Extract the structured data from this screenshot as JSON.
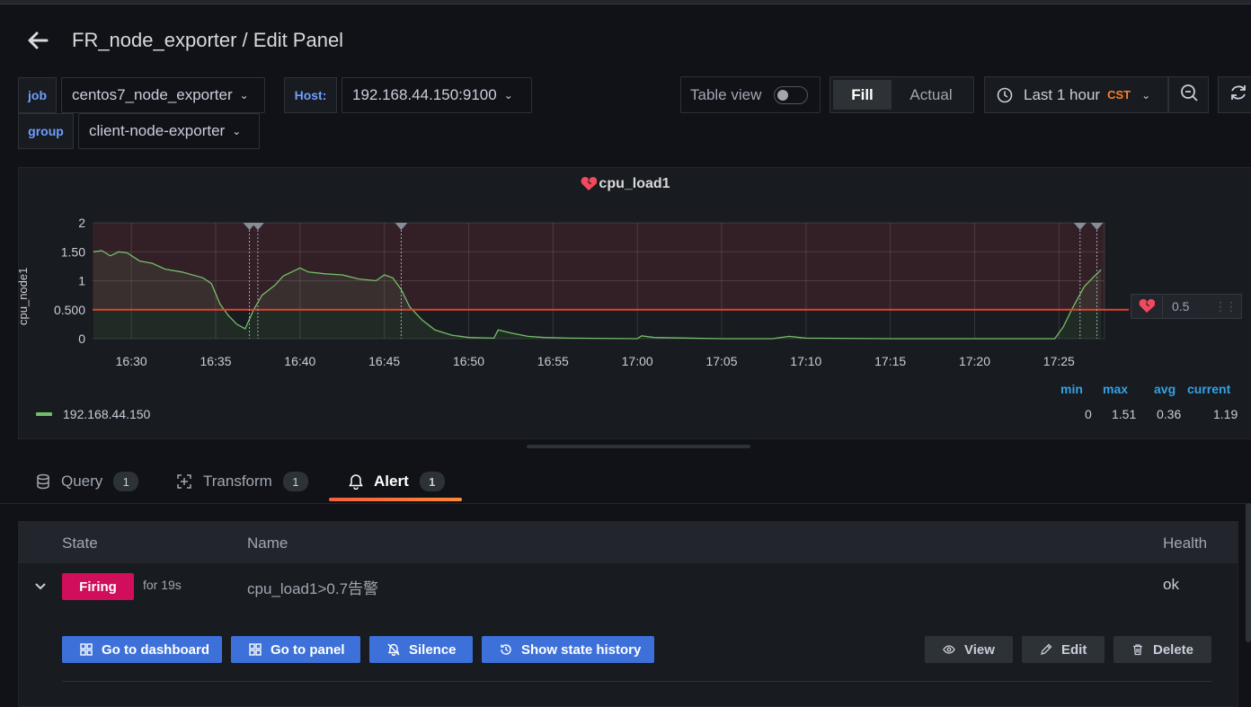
{
  "header": {
    "title": "FR_node_exporter / Edit Panel"
  },
  "variables": [
    {
      "label": "job",
      "value": "centos7_node_exporter"
    },
    {
      "label": "Host:",
      "value": "192.168.44.150:9100"
    },
    {
      "label": "group",
      "value": "client-node-exporter"
    }
  ],
  "toolbar": {
    "table_view_label": "Table view",
    "fill_label": "Fill",
    "actual_label": "Actual",
    "time_range": "Last 1 hour",
    "timezone": "CST"
  },
  "panel": {
    "title": "cpu_load1",
    "threshold_value": "0.5",
    "legend": {
      "headers": [
        "min",
        "max",
        "avg",
        "current"
      ],
      "series_name": "192.168.44.150",
      "series_color": "#73bf69",
      "values": [
        "0",
        "1.51",
        "0.36",
        "1.19"
      ]
    }
  },
  "chart_data": {
    "type": "line",
    "title": "cpu_load1",
    "ylabel": "cpu_node1",
    "ylim": [
      0,
      2
    ],
    "y_ticks": [
      "0",
      "0.500",
      "1",
      "1.50",
      "2"
    ],
    "x_ticks": [
      "16:30",
      "16:35",
      "16:40",
      "16:45",
      "16:50",
      "16:55",
      "17:00",
      "17:05",
      "17:10",
      "17:15",
      "17:20",
      "17:25"
    ],
    "threshold": 0.5,
    "annotations": [
      "16:37:30",
      "16:46:00",
      "17:26:15",
      "17:27:15"
    ],
    "series": [
      {
        "name": "192.168.44.150",
        "color": "#73bf69",
        "points": [
          [
            "16:27:45",
            1.5
          ],
          [
            "16:28:15",
            1.52
          ],
          [
            "16:28:45",
            1.43
          ],
          [
            "16:29:15",
            1.5
          ],
          [
            "16:29:45",
            1.48
          ],
          [
            "16:30:30",
            1.34
          ],
          [
            "16:31:15",
            1.3
          ],
          [
            "16:32:00",
            1.2
          ],
          [
            "16:33:00",
            1.15
          ],
          [
            "16:34:15",
            1.05
          ],
          [
            "16:34:45",
            0.95
          ],
          [
            "16:35:15",
            0.6
          ],
          [
            "16:35:45",
            0.4
          ],
          [
            "16:36:15",
            0.25
          ],
          [
            "16:36:45",
            0.17
          ],
          [
            "16:37:15",
            0.5
          ],
          [
            "16:37:45",
            0.75
          ],
          [
            "16:38:30",
            0.92
          ],
          [
            "16:39:00",
            1.08
          ],
          [
            "16:39:30",
            1.15
          ],
          [
            "16:40:00",
            1.22
          ],
          [
            "16:40:30",
            1.15
          ],
          [
            "16:41:30",
            1.12
          ],
          [
            "16:42:30",
            1.1
          ],
          [
            "16:43:30",
            1.03
          ],
          [
            "16:44:30",
            1.0
          ],
          [
            "16:45:00",
            1.1
          ],
          [
            "16:45:30",
            1.05
          ],
          [
            "16:46:00",
            0.85
          ],
          [
            "16:46:30",
            0.55
          ],
          [
            "16:47:15",
            0.32
          ],
          [
            "16:48:00",
            0.15
          ],
          [
            "16:49:00",
            0.06
          ],
          [
            "16:50:00",
            0.02
          ],
          [
            "16:51:30",
            0.01
          ],
          [
            "16:51:45",
            0.15
          ],
          [
            "16:52:30",
            0.1
          ],
          [
            "16:53:30",
            0.04
          ],
          [
            "16:54:30",
            0.02
          ],
          [
            "16:56:00",
            0.01
          ],
          [
            "17:00:00",
            0.0
          ],
          [
            "17:00:15",
            0.05
          ],
          [
            "17:01:00",
            0.02
          ],
          [
            "17:05:00",
            0.0
          ],
          [
            "17:08:00",
            0.0
          ],
          [
            "17:09:00",
            0.04
          ],
          [
            "17:10:00",
            0.01
          ],
          [
            "17:15:00",
            0.0
          ],
          [
            "17:20:00",
            0.0
          ],
          [
            "17:24:45",
            0.0
          ],
          [
            "17:25:15",
            0.2
          ],
          [
            "17:25:45",
            0.5
          ],
          [
            "17:26:30",
            0.9
          ],
          [
            "17:27:00",
            1.05
          ],
          [
            "17:27:30",
            1.19
          ]
        ]
      }
    ]
  },
  "tabs": [
    {
      "label": "Query",
      "count": "1"
    },
    {
      "label": "Transform",
      "count": "1"
    },
    {
      "label": "Alert",
      "count": "1"
    }
  ],
  "alert_table": {
    "headers": {
      "state": "State",
      "name": "Name",
      "health": "Health"
    },
    "row": {
      "state": "Firing",
      "duration": "for 19s",
      "name": "cpu_load1>0.7告警",
      "health": "ok"
    },
    "actions": {
      "go_to_dashboard": "Go to dashboard",
      "go_to_panel": "Go to panel",
      "silence": "Silence",
      "show_state_history": "Show state history",
      "view": "View",
      "edit": "Edit",
      "delete": "Delete"
    }
  }
}
